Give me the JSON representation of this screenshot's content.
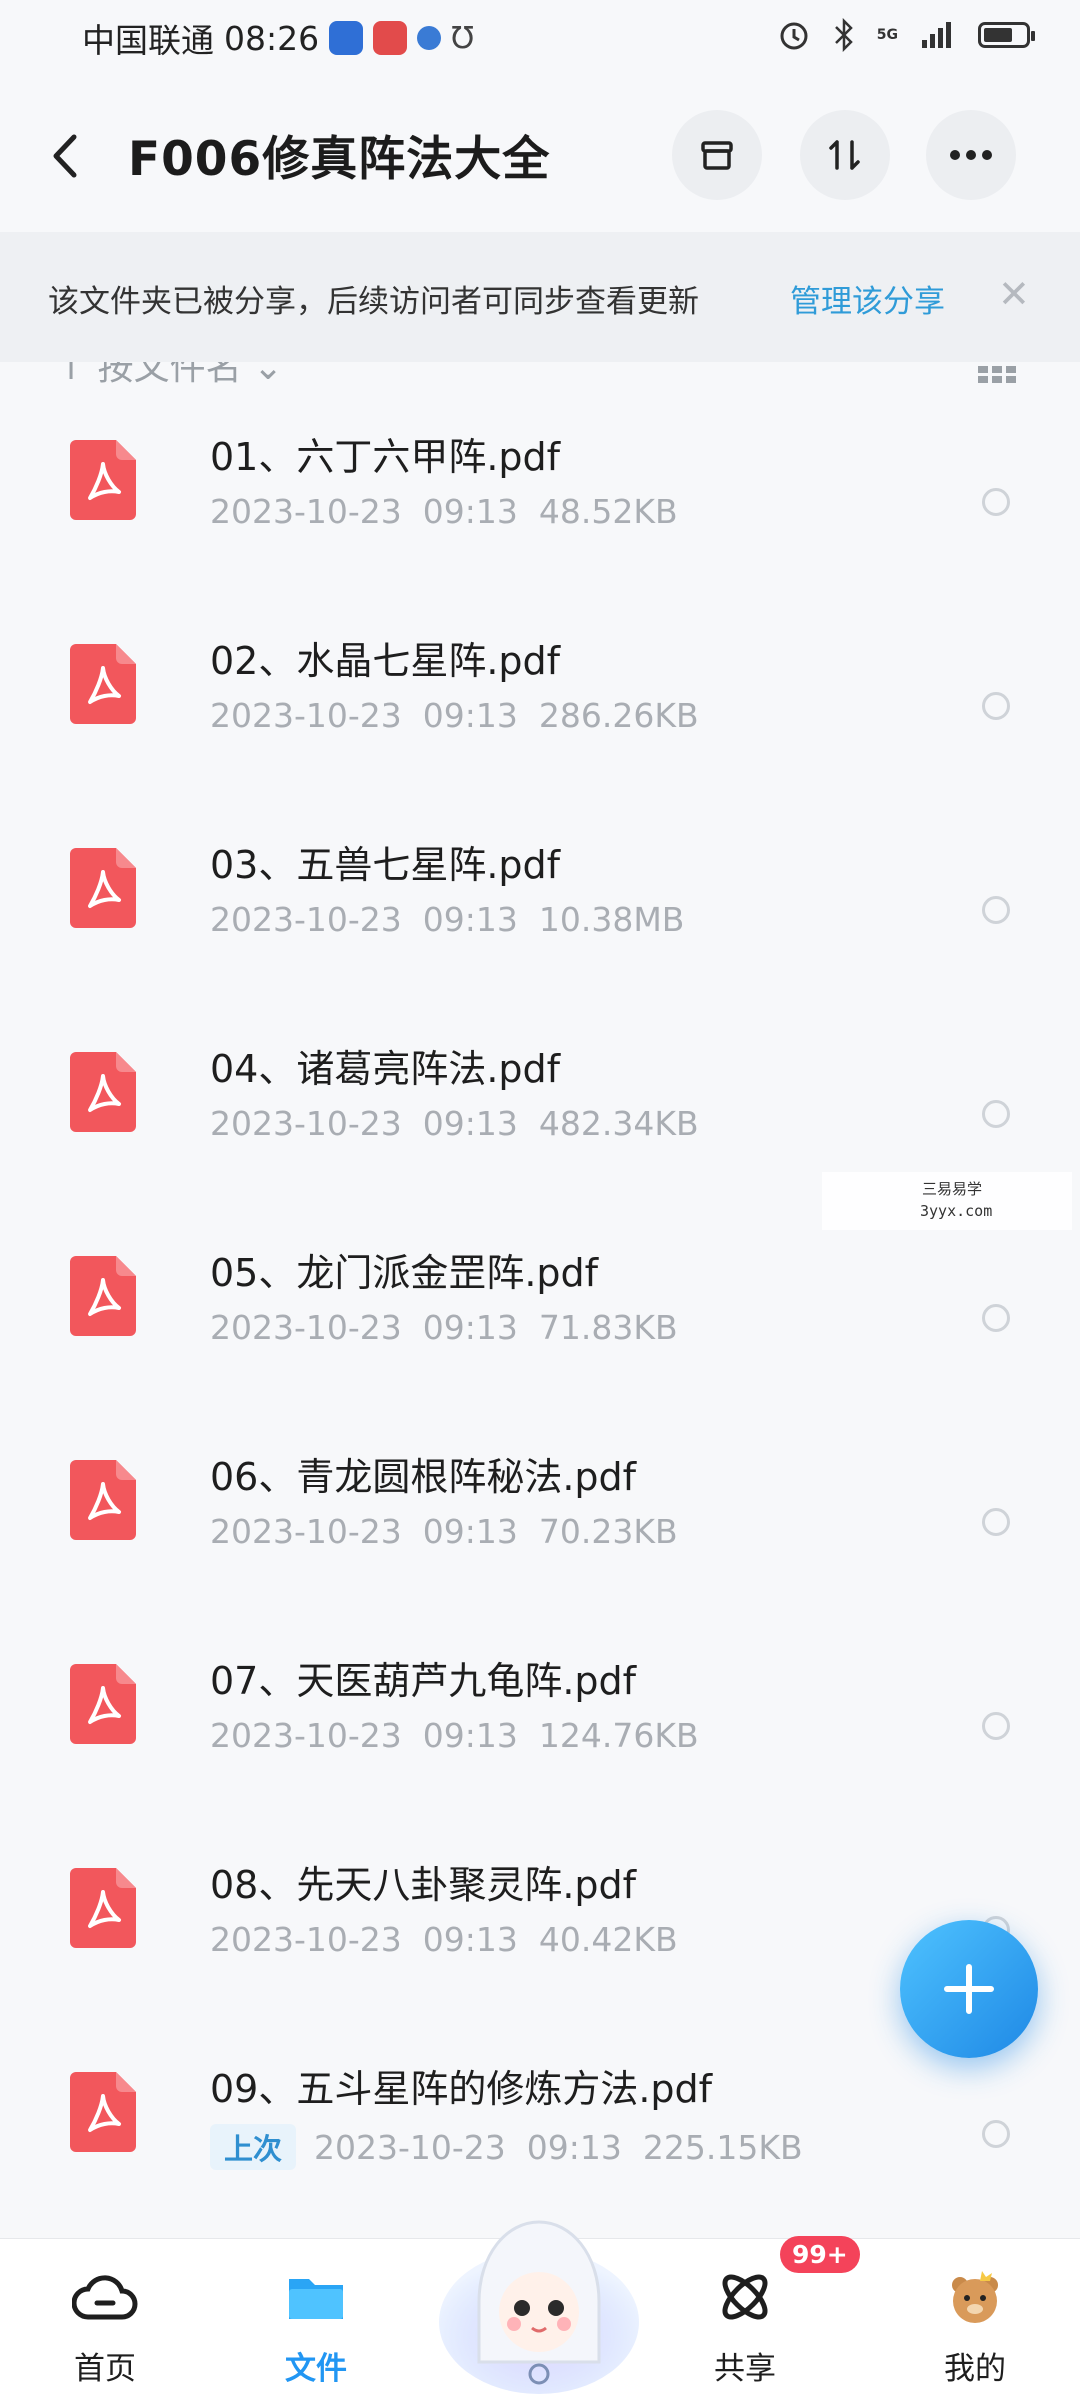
{
  "status_bar": {
    "carrier": "中国联通",
    "time": "08:26",
    "network": "5G"
  },
  "header": {
    "title": "F006修真阵法大全",
    "actions": [
      "archive-icon",
      "sort-swap-icon",
      "more-icon"
    ]
  },
  "share_banner": {
    "message": "该文件夹已被分享，后续访问者可同步查看更新",
    "link": "管理该分享"
  },
  "sort": {
    "label": "↑ 按文件名 ⌄"
  },
  "files": [
    {
      "name": "01、六丁六甲阵.pdf",
      "date": "2023-10-23",
      "time": "09:13",
      "size": "48.52KB"
    },
    {
      "name": "02、水晶七星阵.pdf",
      "date": "2023-10-23",
      "time": "09:13",
      "size": "286.26KB"
    },
    {
      "name": "03、五兽七星阵.pdf",
      "date": "2023-10-23",
      "time": "09:13",
      "size": "10.38MB"
    },
    {
      "name": "04、诸葛亮阵法.pdf",
      "date": "2023-10-23",
      "time": "09:13",
      "size": "482.34KB"
    },
    {
      "name": "05、龙门派金罡阵.pdf",
      "date": "2023-10-23",
      "time": "09:13",
      "size": "71.83KB"
    },
    {
      "name": "06、青龙圆根阵秘法.pdf",
      "date": "2023-10-23",
      "time": "09:13",
      "size": "70.23KB"
    },
    {
      "name": "07、天医葫芦九龟阵.pdf",
      "date": "2023-10-23",
      "time": "09:13",
      "size": "124.76KB"
    },
    {
      "name": "08、先天八卦聚灵阵.pdf",
      "date": "2023-10-23",
      "time": "09:13",
      "size": "40.42KB"
    },
    {
      "name": "09、五斗星阵的修炼方法.pdf",
      "badge": "上次",
      "date": "2023-10-23",
      "time": "09:13",
      "size": "225.15KB"
    }
  ],
  "watermark": {
    "line1": "三易易学",
    "line2": "3yyx.com"
  },
  "bottom_nav": {
    "items": [
      {
        "label": "首页",
        "icon": "home-cloud-icon"
      },
      {
        "label": "文件",
        "icon": "folder-icon",
        "active": true
      },
      {
        "label": "共享",
        "icon": "share-atom-icon",
        "badge": "99+"
      },
      {
        "label": "我的",
        "icon": "profile-bear-icon"
      }
    ]
  },
  "colors": {
    "accent": "#2196f3",
    "link": "#2f9bd8",
    "pdf_red": "#f2575c",
    "badge_red": "#f4435a"
  }
}
